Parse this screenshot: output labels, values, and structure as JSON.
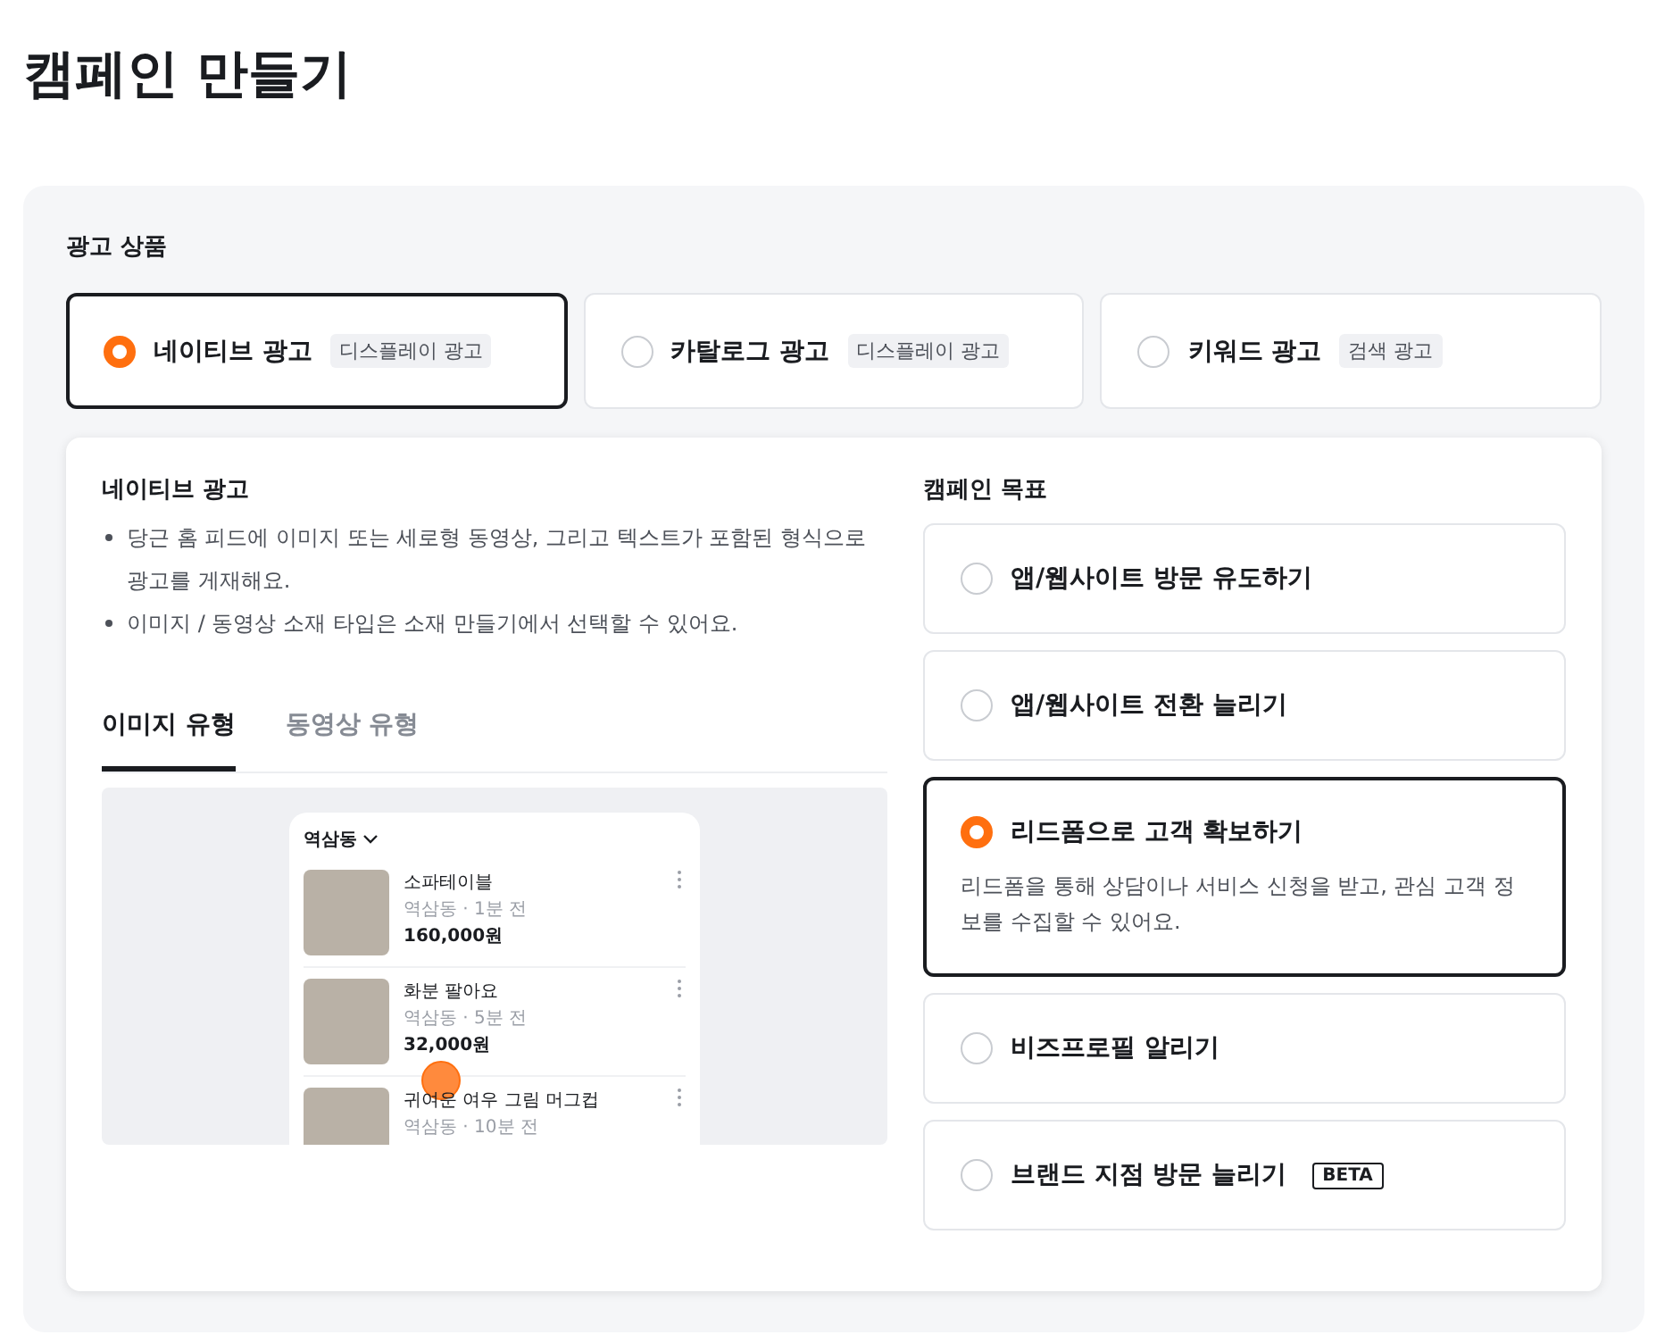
{
  "page_title": "캠페인 만들기",
  "ad_products": {
    "label": "광고 상품",
    "options": [
      {
        "name": "네이티브 광고",
        "tag": "디스플레이 광고",
        "selected": true
      },
      {
        "name": "카탈로그 광고",
        "tag": "디스플레이 광고",
        "selected": false
      },
      {
        "name": "키워드 광고",
        "tag": "검색 광고",
        "selected": false
      }
    ]
  },
  "description": {
    "title": "네이티브 광고",
    "bullets": [
      "당근 홈 피드에 이미지 또는 세로형 동영상, 그리고 텍스트가 포함된 형식으로 광고를 게재해요.",
      "이미지 / 동영상 소재 타입은 소재 만들기에서 선택할 수 있어요."
    ]
  },
  "tabs": [
    {
      "label": "이미지 유형",
      "selected": true
    },
    {
      "label": "동영상 유형",
      "selected": false
    }
  ],
  "preview": {
    "location": "역삼동",
    "items": [
      {
        "title": "소파테이블",
        "meta": "역삼동 · 1분 전",
        "price": "160,000원"
      },
      {
        "title": "화분 팔아요",
        "meta": "역삼동 · 5분 전",
        "price": "32,000원"
      },
      {
        "title": "귀여운 여우 그림 머그컵",
        "meta": "역삼동 · 10분 전"
      }
    ]
  },
  "goals": {
    "label": "캠페인 목표",
    "options": [
      {
        "label": "앱/웹사이트 방문 유도하기",
        "selected": false
      },
      {
        "label": "앱/웹사이트 전환 늘리기",
        "selected": false
      },
      {
        "label": "리드폼으로 고객 확보하기",
        "selected": true,
        "description": "리드폼을 통해 상담이나 서비스 신청을 받고, 관심 고객 정보를 수집할 수 있어요."
      },
      {
        "label": "비즈프로필 알리기",
        "selected": false
      },
      {
        "label": "브랜드 지점 방문 늘리기",
        "selected": false,
        "badge": "BETA"
      }
    ]
  }
}
